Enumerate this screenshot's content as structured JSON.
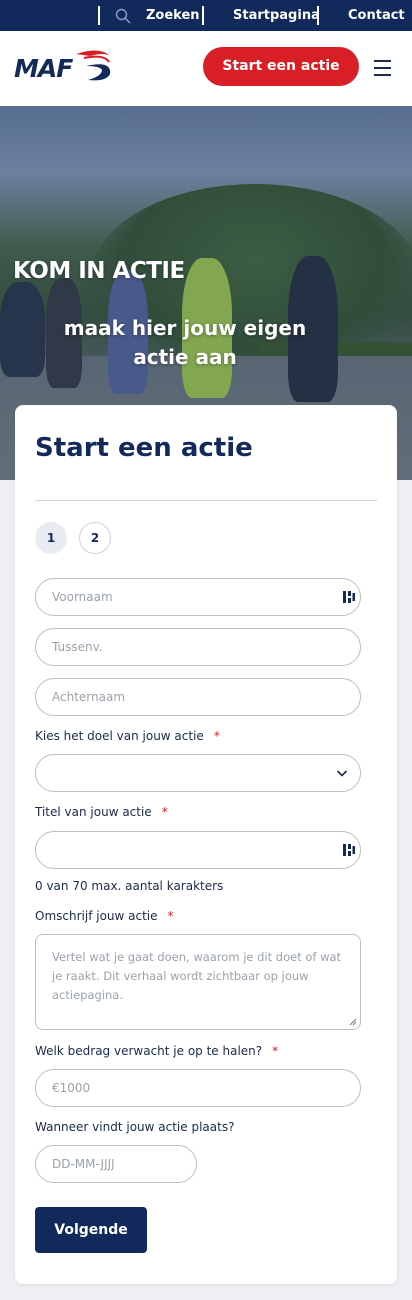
{
  "topbar": {
    "search_label": "Zoeken",
    "home_label": "Startpagina",
    "contact_label": "Contact"
  },
  "header": {
    "logo_text": "MAF",
    "cta_label": "Start een actie",
    "menu_icon": "hamburger-icon"
  },
  "hero": {
    "title": "KOM IN ACTIE",
    "subtitle": "maak hier jouw eigen actie aan"
  },
  "form": {
    "title": "Start een actie",
    "steps": [
      "1",
      "2"
    ],
    "first_name_placeholder": "Voornaam",
    "infix_placeholder": "Tussenv.",
    "last_name_placeholder": "Achternaam",
    "goal_label": "Kies het doel van jouw actie",
    "goal_value": "",
    "title_label": "Titel van jouw actie",
    "title_value": "",
    "title_counter": "0 van 70 max. aantal karakters",
    "description_label": "Omschrijf jouw actie",
    "description_placeholder": "Vertel wat je gaat doen, waarom je dit doet of wat je raakt. Dit verhaal wordt zichtbaar op jouw actiepagina.",
    "amount_label": "Welk bedrag verwacht je op te halen?",
    "amount_placeholder": "€1000",
    "date_label": "Wanneer vindt jouw actie plaats?",
    "date_placeholder": "DD-MM-JJJJ",
    "required_marker": "*",
    "next_label": "Volgende"
  },
  "colors": {
    "navy": "#12295c",
    "brand_red": "#d81f26"
  }
}
